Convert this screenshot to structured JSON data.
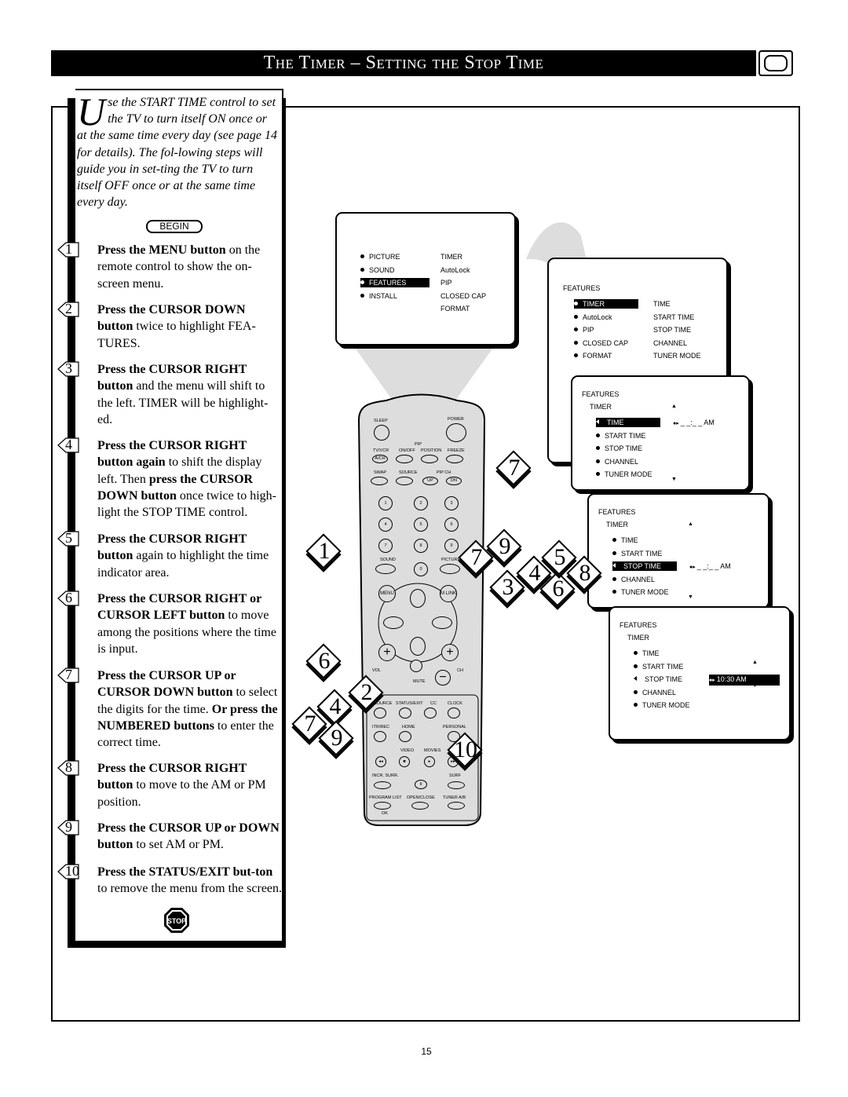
{
  "title": "The Timer – Setting the Stop Time",
  "intro": {
    "dropcap": "U",
    "text": "se the START TIME control to set the TV to turn itself ON once or at the same time every day (see page 14  for details). The fol-lowing steps will guide you in set-ting the TV to turn itself OFF once or at the same time every day.",
    "begin_label": "BEGIN"
  },
  "steps": [
    {
      "num": "1",
      "parts": [
        [
          "Press the MENU button",
          true
        ],
        [
          " on the remote control to show the on-screen menu.",
          false
        ]
      ]
    },
    {
      "num": "2",
      "parts": [
        [
          "Press the CURSOR DOWN button",
          true
        ],
        [
          " twice to highlight FEA-TURES.",
          false
        ]
      ]
    },
    {
      "num": "3",
      "parts": [
        [
          "Press the CURSOR RIGHT button",
          true
        ],
        [
          " and the menu will shift to the left. TIMER will be highlight-ed.",
          false
        ]
      ]
    },
    {
      "num": "4",
      "parts": [
        [
          "Press the CURSOR RIGHT button again",
          true
        ],
        [
          " to shift the display left. Then ",
          false
        ],
        [
          "press the CURSOR DOWN button",
          true
        ],
        [
          " once twice to high-light the STOP TIME control.",
          false
        ]
      ]
    },
    {
      "num": "5",
      "parts": [
        [
          "Press the CURSOR RIGHT button",
          true
        ],
        [
          " again to highlight the time indicator area.",
          false
        ]
      ]
    },
    {
      "num": "6",
      "parts": [
        [
          "Press the CURSOR RIGHT or CURSOR LEFT button",
          true
        ],
        [
          " to move among the positions where the time is input.",
          false
        ]
      ]
    },
    {
      "num": "7",
      "parts": [
        [
          "Press the CURSOR UP or CURSOR DOWN button",
          true
        ],
        [
          " to select the digits for the time. ",
          false
        ],
        [
          "Or press the NUMBERED buttons",
          true
        ],
        [
          " to enter the correct time.",
          false
        ]
      ]
    },
    {
      "num": "8",
      "parts": [
        [
          "Press the CURSOR RIGHT button",
          true
        ],
        [
          " to move to the AM or PM position.",
          false
        ]
      ]
    },
    {
      "num": "9",
      "parts": [
        [
          "Press the CURSOR UP or DOWN button",
          true
        ],
        [
          " to set AM or PM.",
          false
        ]
      ]
    },
    {
      "num": "10",
      "parts": [
        [
          "Press the STATUS/EXIT but-ton",
          true
        ],
        [
          " to remove the menu from the screen.",
          false
        ]
      ]
    }
  ],
  "stop_sign": "STOP",
  "menus": {
    "main": {
      "left": [
        "PICTURE",
        "SOUND",
        "FEATURES",
        "INSTALL"
      ],
      "right": [
        "TIMER",
        "AutoLock",
        "PIP",
        "CLOSED CAP",
        "FORMAT"
      ],
      "selected": "FEATURES"
    },
    "features": {
      "header": "FEATURES",
      "left": [
        "TIMER",
        "AutoLock",
        "PIP",
        "CLOSED CAP",
        "FORMAT"
      ],
      "right": [
        "TIME",
        "START TIME",
        "STOP TIME",
        "CHANNEL",
        "TUNER MODE"
      ],
      "selected": "TIMER"
    },
    "timer1": {
      "header": "FEATURES",
      "sub": "TIMER",
      "items": [
        "TIME",
        "START TIME",
        "STOP TIME",
        "CHANNEL",
        "TUNER MODE"
      ],
      "selected": "TIME",
      "value": "_ _:_ _  AM"
    },
    "timer2": {
      "header": "FEATURES",
      "sub": "TIMER",
      "items": [
        "TIME",
        "START TIME",
        "STOP TIME",
        "CHANNEL",
        "TUNER MODE"
      ],
      "selected": "STOP TIME",
      "value": "_ _:_ _  AM"
    },
    "timer3": {
      "header": "FEATURES",
      "sub": "TIMER",
      "items": [
        "TIME",
        "START TIME",
        "STOP TIME",
        "CHANNEL",
        "TUNER MODE"
      ],
      "selected": "STOP TIME",
      "value": "10:30  AM"
    }
  },
  "remote": {
    "labels": {
      "sleep": "SLEEP",
      "power": "POWER",
      "pip": "PIP",
      "tvvcr": "TV/VCR",
      "ach": "A/CH",
      "onoff": "ON/OFF",
      "position": "POSITION",
      "freeze": "FREEZE",
      "swap": "SWAP",
      "source": "SOURCE",
      "pipch": "PIP CH",
      "up": "UP",
      "dn": "DN",
      "sound": "SOUND",
      "picture": "PICTURE",
      "menu": "MENU",
      "mlink": "M LINK",
      "vol": "VOL",
      "ch": "CH",
      "mute": "MUTE",
      "source2": "SOURCE",
      "statusexit": "STATUS/EXIT",
      "cc": "CC",
      "clock": "CLOCK",
      "itrrec": "ITR/REC",
      "home": "HOME",
      "personal": "PERSONAL",
      "video": "VIDEO",
      "movies": "MOVIES",
      "incrsurr": "INCR. SURR.",
      "surf": "SURF",
      "programlist": "PROGRAM LIST",
      "openclose": "OPEN/CLOSE",
      "tunerab": "TUNER A/B",
      "ok": "OK"
    },
    "digits": [
      "1",
      "2",
      "3",
      "4",
      "5",
      "6",
      "7",
      "8",
      "9",
      "0"
    ]
  },
  "callouts": [
    "1",
    "6",
    "4",
    "7",
    "9",
    "2",
    "7",
    "9",
    "7",
    "3",
    "4",
    "6",
    "5",
    "8",
    "10"
  ],
  "page_number": "15"
}
